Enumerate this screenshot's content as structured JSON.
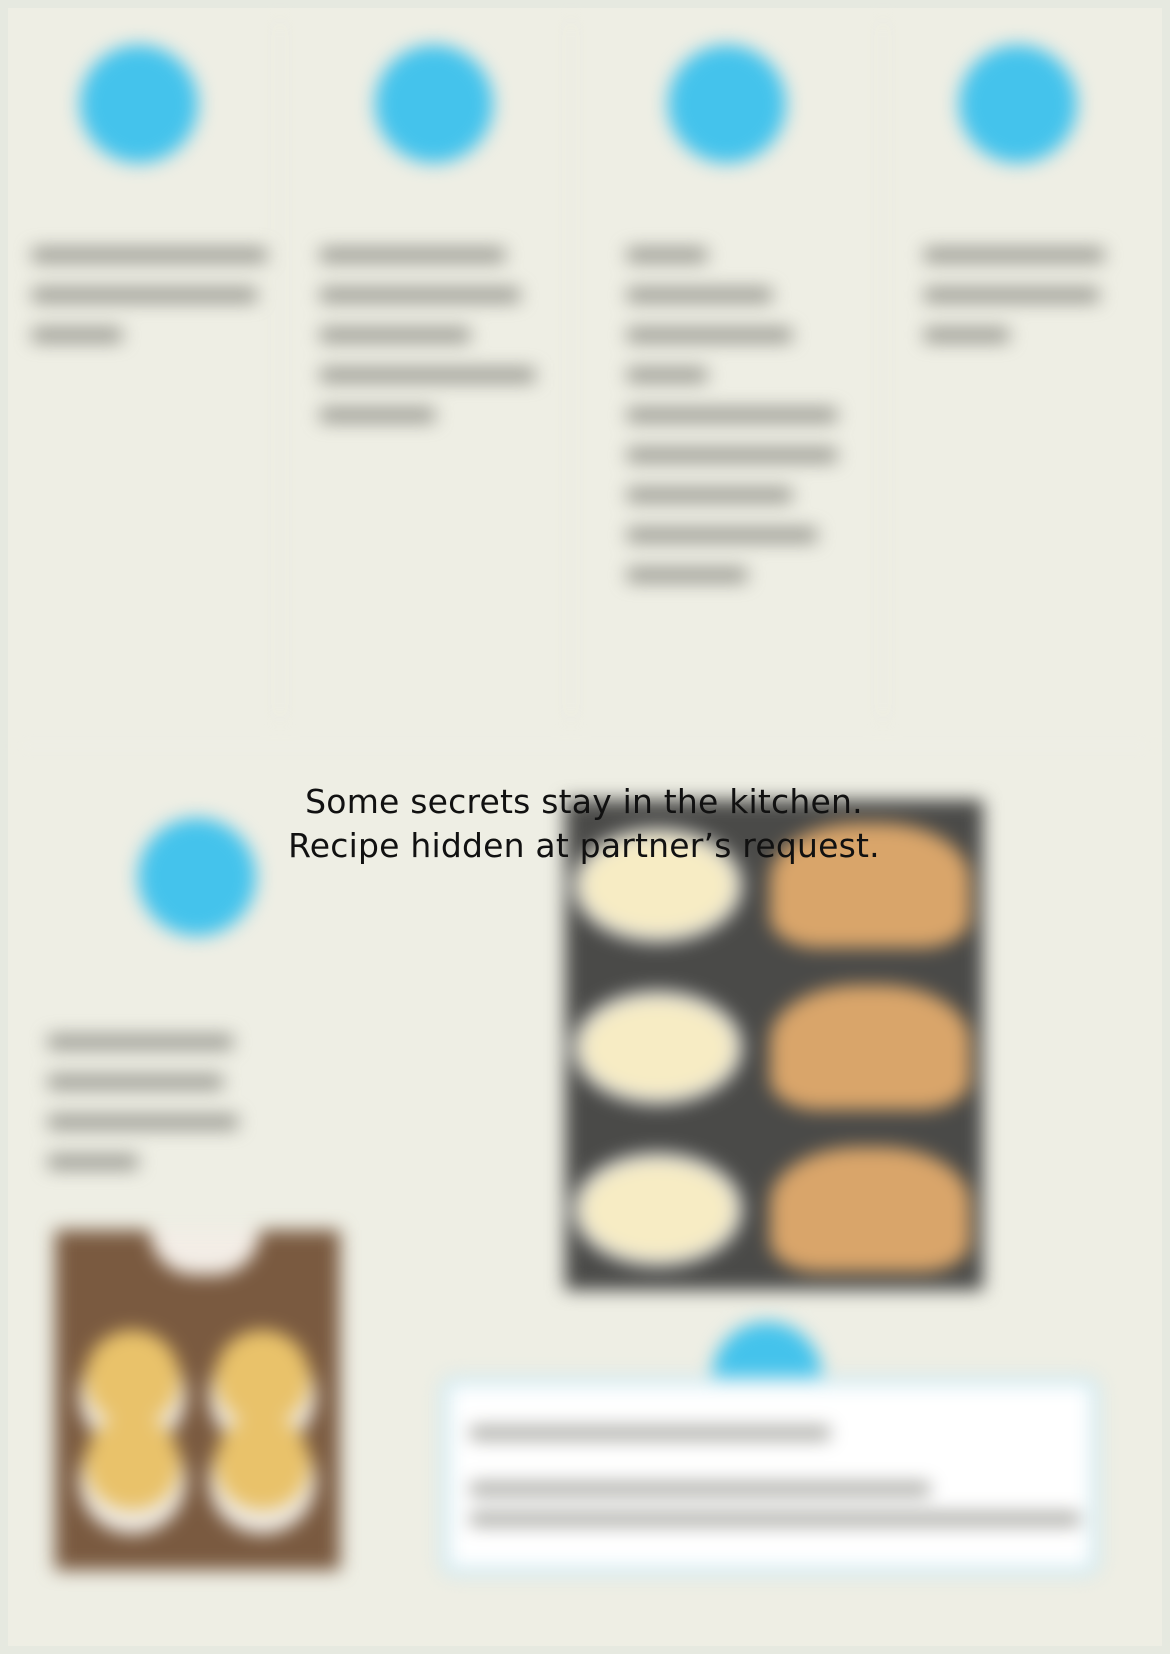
{
  "overlay": {
    "line1": "Some secrets stay in the kitchen.",
    "line2": "Recipe hidden at partner’s request."
  },
  "colors": {
    "background": "#eeeee4",
    "step_circle": "#44c3ec",
    "overlay_text": "#111111",
    "tip_border": "#cfe9f1"
  }
}
